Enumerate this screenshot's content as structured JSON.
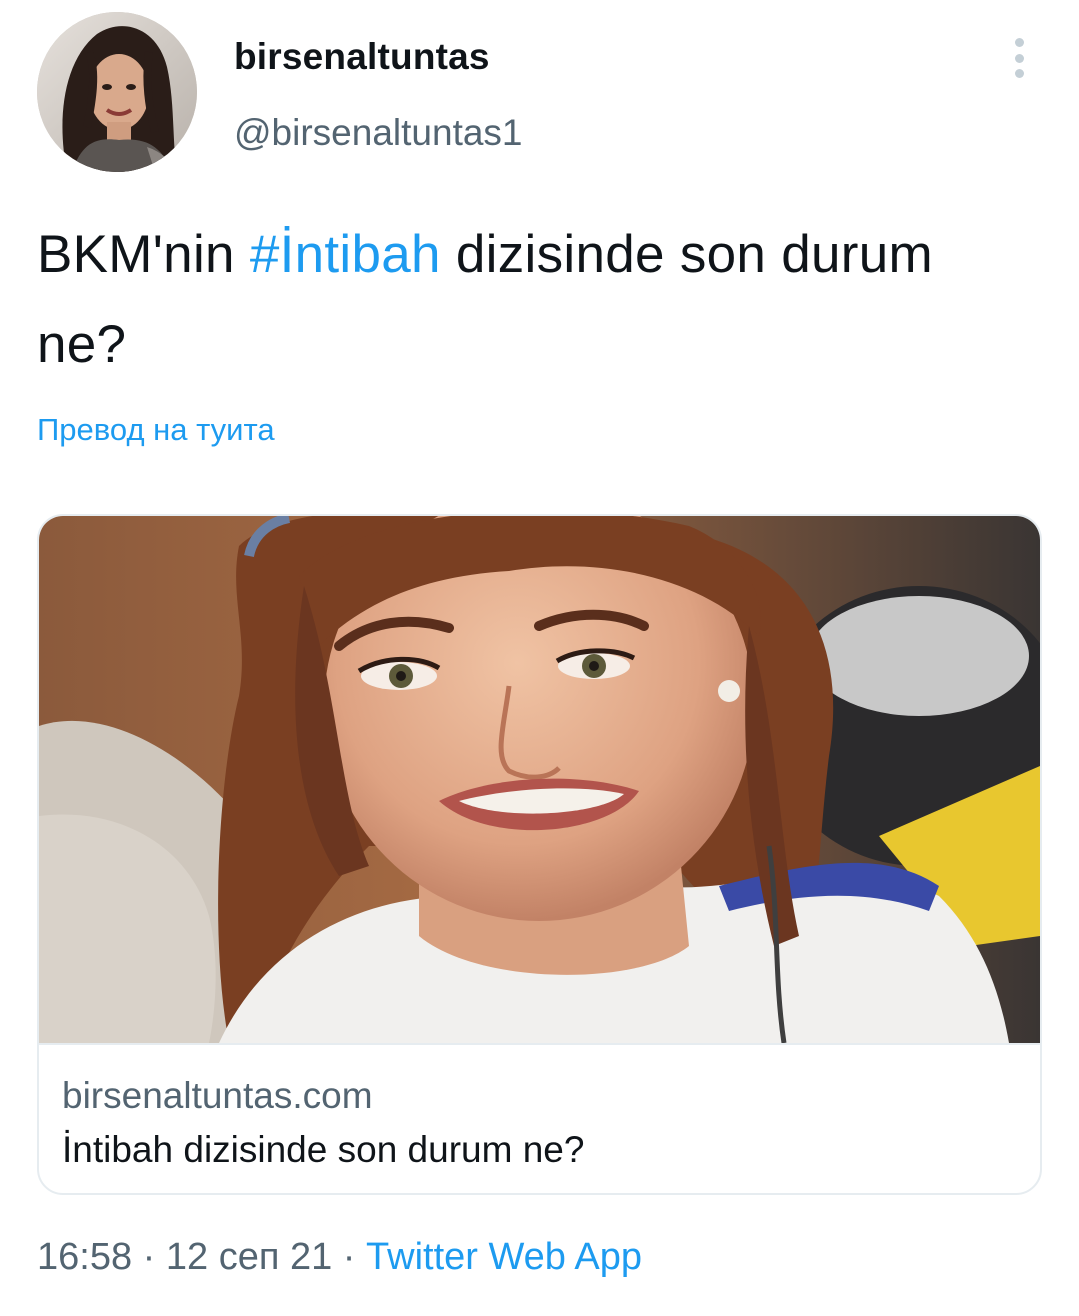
{
  "user": {
    "display_name": "birsenaltuntas",
    "handle": "@birsenaltuntas1"
  },
  "tweet": {
    "text_before": "BKM'nin ",
    "hashtag": "#İntibah",
    "text_after": " dizisinde son durum ne?",
    "translate_label": "Превод на туита"
  },
  "card": {
    "domain": "birsenaltuntas.com",
    "title": "İntibah dizisinde son durum ne?"
  },
  "meta": {
    "time": "16:58",
    "separator": " · ",
    "date": "12 сеп 21",
    "source": "Twitter Web App"
  },
  "icons": {
    "more": "more-vertical-icon"
  },
  "colors": {
    "accent": "#1d9bf0",
    "secondary_text": "#536471",
    "primary_text": "#0f1419",
    "border": "#e6ecf0"
  }
}
